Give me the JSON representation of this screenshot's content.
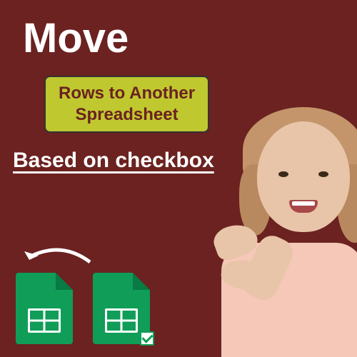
{
  "title": "Move",
  "subtitle_line1": "Rows to Another",
  "subtitle_line2": "Spreadsheet",
  "tagline": "Based on checkbox",
  "colors": {
    "background": "#6b2220",
    "accent_box": "#bfc82f",
    "sheets_green": "#0f9d58"
  }
}
